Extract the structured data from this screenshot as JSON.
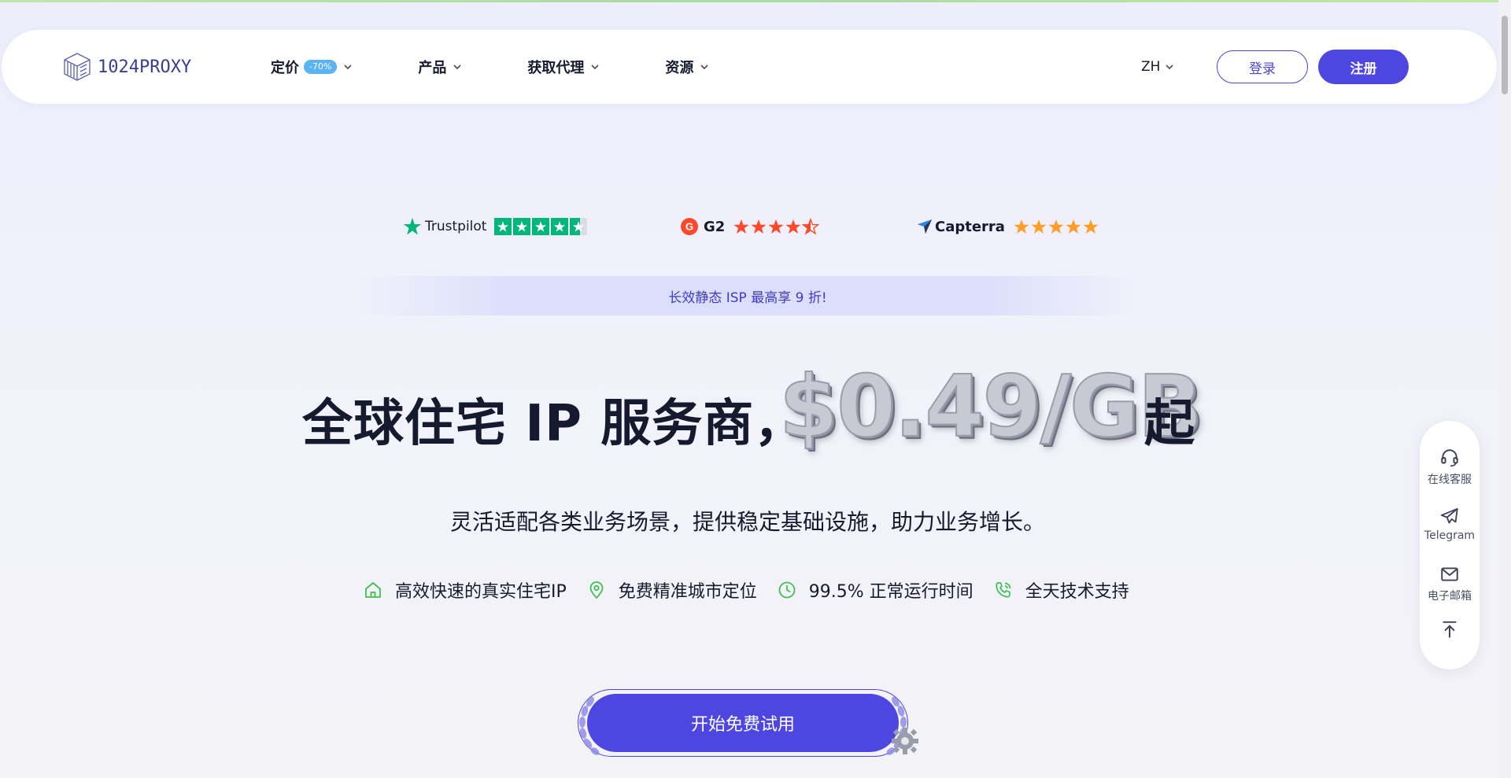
{
  "header": {
    "logo_number": "1024",
    "logo_text": "PROXY",
    "nav": [
      {
        "label": "定价",
        "badge": "-70%"
      },
      {
        "label": "产品"
      },
      {
        "label": "获取代理"
      },
      {
        "label": "资源"
      }
    ],
    "language": "ZH",
    "login_label": "登录",
    "signup_label": "注册"
  },
  "ratings": [
    {
      "name": "Trustpilot",
      "stars": 5
    },
    {
      "name": "G2",
      "stars": 4.5
    },
    {
      "name": "Capterra",
      "stars": 5
    }
  ],
  "promo": "长效静态 ISP 最高享 9 折!",
  "hero": {
    "title_left": "全球住宅 IP 服务商，",
    "price": "$0.49/GB",
    "title_right": "起",
    "subtitle": "灵活适配各类业务场景，提供稳定基础设施，助力业务增长。"
  },
  "features": [
    {
      "icon": "home-icon",
      "label": "高效快速的真实住宅IP"
    },
    {
      "icon": "location-pin-icon",
      "label": "免费精准城市定位"
    },
    {
      "icon": "clock-icon",
      "label": "99.5% 正常运行时间"
    },
    {
      "icon": "phone-icon",
      "label": "全天技术支持"
    }
  ],
  "cta": {
    "label": "开始免费试用"
  },
  "side": [
    {
      "icon": "headset-icon",
      "label": "在线客服"
    },
    {
      "icon": "telegram-icon",
      "label": "Telegram"
    },
    {
      "icon": "mail-icon",
      "label": "电子邮箱"
    },
    {
      "icon": "back-to-top-icon",
      "label": ""
    }
  ],
  "colors": {
    "primary": "#4d46e0",
    "feature_icon": "#3fbf4f",
    "trustpilot": "#00b67a",
    "g2": "#ff492c",
    "capterra_star": "#ff9d28",
    "badge": "#5ab3f2"
  }
}
